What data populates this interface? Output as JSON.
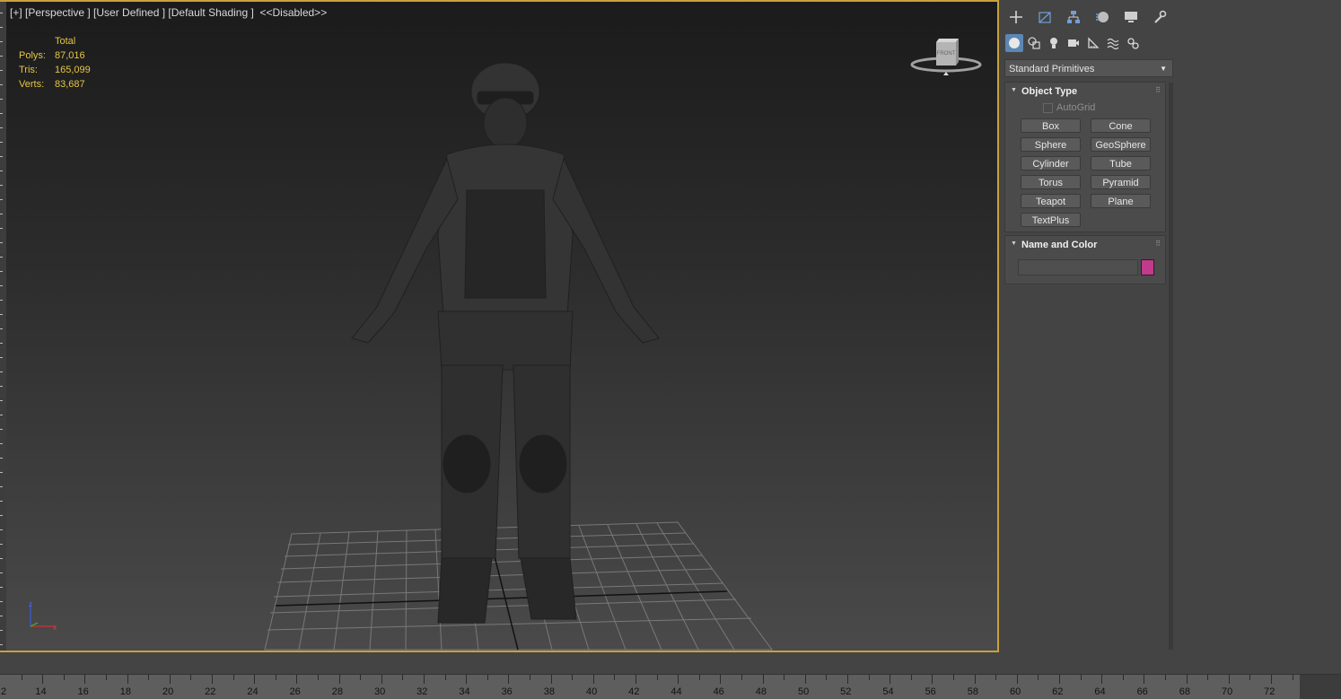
{
  "viewport": {
    "label": "[+] [Perspective ] [User Defined ] [Default Shading ]  <<Disabled>>",
    "stats": {
      "header": "Total",
      "rows": [
        {
          "key": "Polys:",
          "value": "87,016"
        },
        {
          "key": "Tris:",
          "value": "165,099"
        },
        {
          "key": "Verts:",
          "value": "83,687"
        }
      ]
    },
    "viewcube_label": "FRONT",
    "axis": {
      "z": "z",
      "x": "x"
    }
  },
  "command_panel": {
    "toolbar_icons": [
      "create-plus-icon",
      "modify-icon",
      "hierarchy-icon",
      "motion-icon",
      "display-icon",
      "utilities-wrench-icon"
    ],
    "category_icons": [
      "geometry-sphere-icon",
      "shapes-icon",
      "lights-icon",
      "cameras-icon",
      "helpers-icon",
      "space-warps-icon",
      "systems-icon"
    ],
    "dropdown": "Standard Primitives",
    "object_type": {
      "title": "Object Type",
      "autogrid": "AutoGrid",
      "buttons": [
        "Box",
        "Cone",
        "Sphere",
        "GeoSphere",
        "Cylinder",
        "Tube",
        "Torus",
        "Pyramid",
        "Teapot",
        "Plane",
        "TextPlus"
      ]
    },
    "name_color": {
      "title": "Name and Color",
      "color": "#c23a8c"
    }
  },
  "timeline": {
    "labels": [
      "2",
      "14",
      "16",
      "18",
      "20",
      "22",
      "24",
      "26",
      "28",
      "30",
      "32",
      "34",
      "36",
      "38",
      "40",
      "42",
      "44",
      "46",
      "48",
      "50",
      "52",
      "54",
      "56",
      "58",
      "60",
      "62",
      "64",
      "66",
      "68",
      "70",
      "72"
    ]
  },
  "colors": {
    "viewport_border": "#c8a13a",
    "stats": "#e5c543",
    "active_tab": "#5b87b5"
  }
}
